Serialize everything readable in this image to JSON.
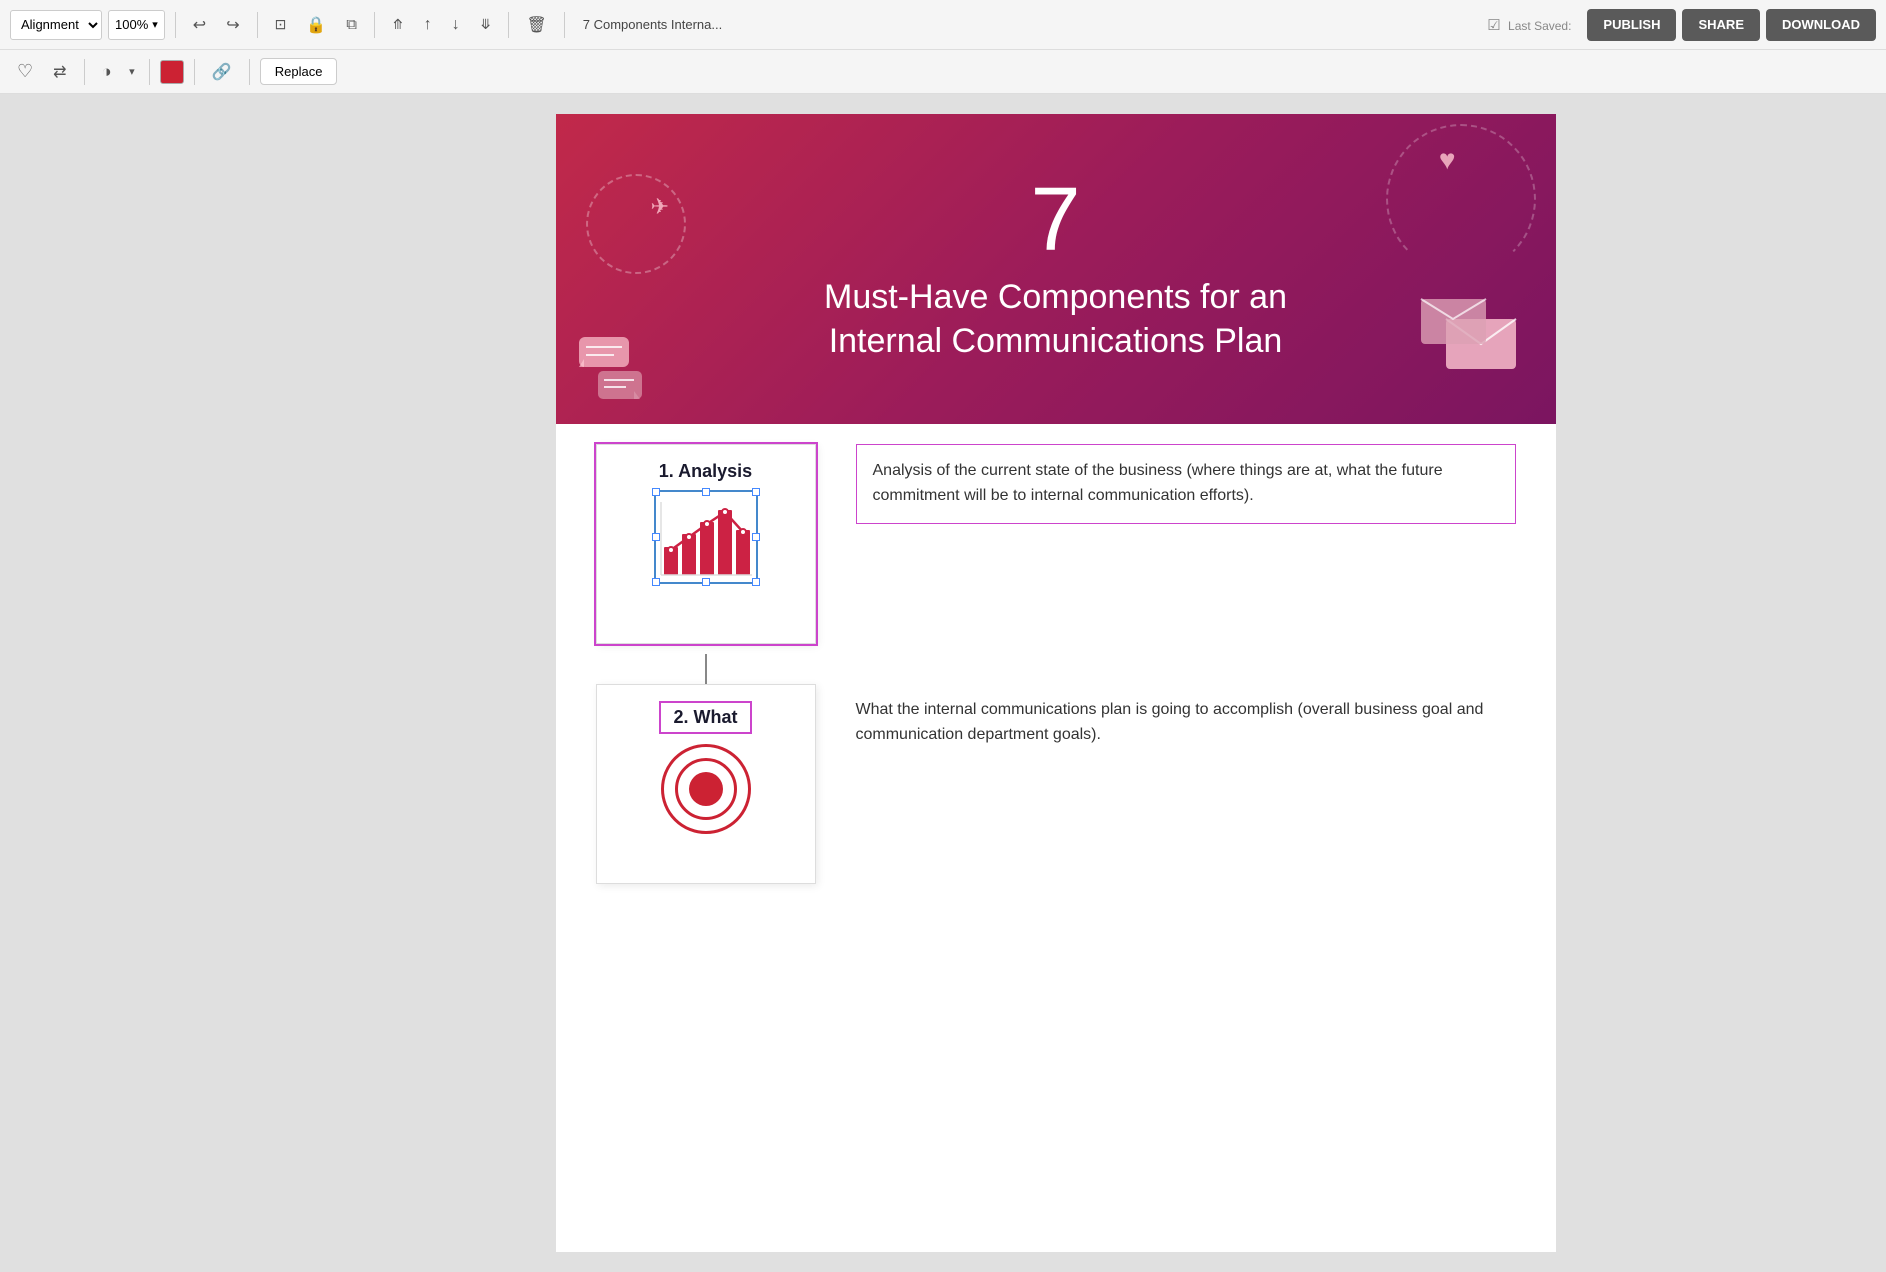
{
  "toolbar": {
    "alignment_label": "Alignment",
    "zoom_label": "100%",
    "filename": "7 Components Interna...",
    "last_saved": "Last Saved:",
    "publish_label": "PUBLISH",
    "share_label": "SHARE",
    "download_label": "DOWNLOAD",
    "replace_label": "Replace"
  },
  "hero": {
    "number": "7",
    "title_line1": "Must-Have Components for an",
    "title_line2": "Internal Communications Plan"
  },
  "items": [
    {
      "id": "item1",
      "number_title": "1. Analysis",
      "description": "Analysis of the current state of the business (where things are at, what the future commitment will be to internal communication efforts).",
      "selected": true,
      "icon_type": "chart"
    },
    {
      "id": "item2",
      "number_title": "2. What",
      "description": "What the internal communications plan is going to accomplish (overall business goal and communication department goals).",
      "selected": false,
      "icon_type": "target"
    }
  ],
  "icons": {
    "undo": "↩",
    "redo": "↪",
    "lock": "🔒",
    "copy": "⧉",
    "move_up_top": "⤊",
    "move_up": "↑",
    "move_down": "↓",
    "move_down_bottom": "⤋",
    "trash": "🗑",
    "heart": "♡",
    "flip": "⇄",
    "contrast": "◑",
    "link": "🔗",
    "chevron_down": "▾"
  }
}
